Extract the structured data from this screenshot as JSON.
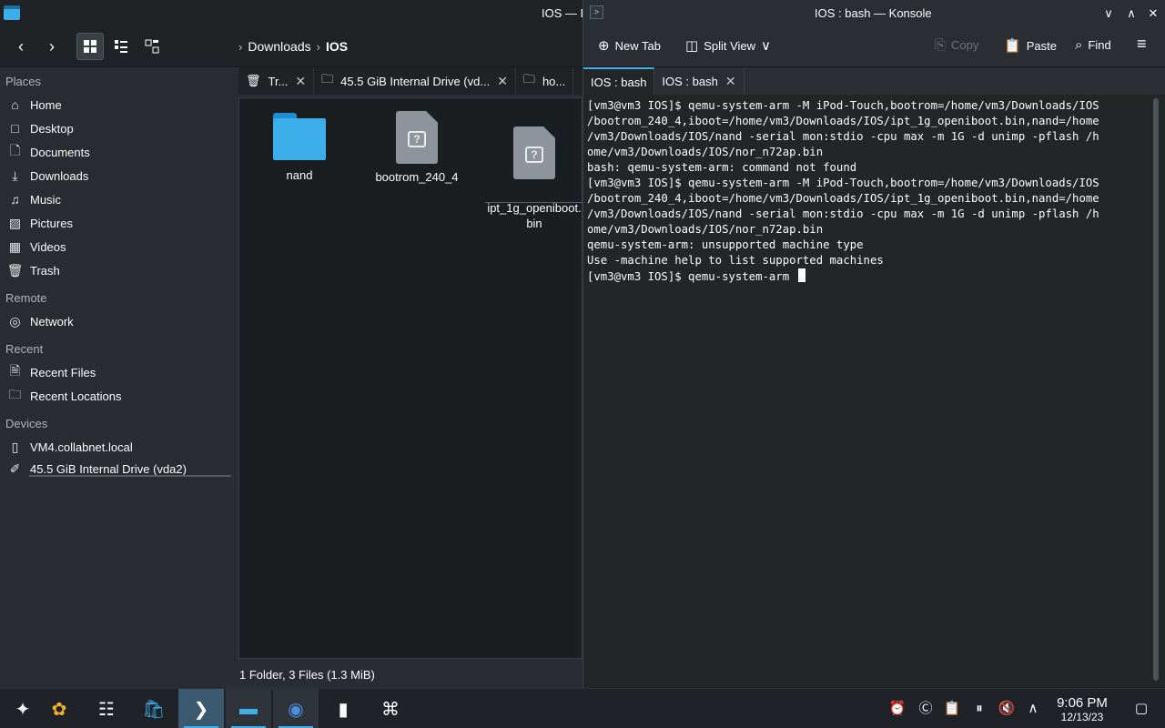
{
  "dolphin": {
    "title": "IOS — D",
    "breadcrumb": {
      "parent": "Downloads",
      "current": "IOS"
    },
    "sidebar": {
      "places_header": "Places",
      "places": [
        {
          "label": "Home",
          "icon": "home-icon"
        },
        {
          "label": "Desktop",
          "icon": "desktop-icon"
        },
        {
          "label": "Documents",
          "icon": "documents-icon"
        },
        {
          "label": "Downloads",
          "icon": "downloads-icon"
        },
        {
          "label": "Music",
          "icon": "music-icon"
        },
        {
          "label": "Pictures",
          "icon": "pictures-icon"
        },
        {
          "label": "Videos",
          "icon": "videos-icon"
        },
        {
          "label": "Trash",
          "icon": "trash-icon"
        }
      ],
      "remote_header": "Remote",
      "remote": [
        {
          "label": "Network",
          "icon": "network-icon"
        }
      ],
      "recent_header": "Recent",
      "recent": [
        {
          "label": "Recent Files",
          "icon": "recent-files-icon"
        },
        {
          "label": "Recent Locations",
          "icon": "recent-locations-icon"
        }
      ],
      "devices_header": "Devices",
      "devices": [
        {
          "label": "VM4.collabnet.local",
          "icon": "phone-icon"
        },
        {
          "label": "45.5 GiB Internal Drive (vda2)",
          "icon": "drive-icon"
        }
      ]
    },
    "tabs": [
      {
        "label": "Tr...",
        "icon": "trash-icon"
      },
      {
        "label": "45.5 GiB Internal Drive (vd...",
        "icon": "folder-icon"
      },
      {
        "label": "ho...",
        "icon": "folder-icon"
      }
    ],
    "files": [
      {
        "name": "nand",
        "type": "folder"
      },
      {
        "name": "bootrom_240_4",
        "type": "unknown"
      },
      {
        "name": "ipt_1g_openiboot.\nbin",
        "type": "unknown"
      }
    ],
    "status": "1 Folder, 3 Files (1.3 MiB)"
  },
  "konsole": {
    "title": "IOS : bash — Konsole",
    "toolbar": {
      "new_tab": "New Tab",
      "split_view": "Split View",
      "copy": "Copy",
      "paste": "Paste",
      "find": "Find"
    },
    "tabs": [
      {
        "label": "IOS : bash"
      },
      {
        "label": "IOS : bash"
      }
    ],
    "terminal_lines": [
      "[vm3@vm3 IOS]$ qemu-system-arm -M iPod-Touch,bootrom=/home/vm3/Downloads/IOS",
      "/bootrom_240_4,iboot=/home/vm3/Downloads/IOS/ipt_1g_openiboot.bin,nand=/home",
      "/vm3/Downloads/IOS/nand -serial mon:stdio -cpu max -m 1G -d unimp -pflash /h",
      "ome/vm3/Downloads/IOS/nor_n72ap.bin",
      "bash: qemu-system-arm: command not found",
      "[vm3@vm3 IOS]$ qemu-system-arm -M iPod-Touch,bootrom=/home/vm3/Downloads/IOS",
      "/bootrom_240_4,iboot=/home/vm3/Downloads/IOS/ipt_1g_openiboot.bin,nand=/home",
      "/vm3/Downloads/IOS/nand -serial mon:stdio -cpu max -m 1G -d unimp -pflash /h",
      "ome/vm3/Downloads/IOS/nor_n72ap.bin",
      "qemu-system-arm: unsupported machine type",
      "Use -machine help to list supported machines"
    ],
    "prompt_line": "[vm3@vm3 IOS]$ qemu-system-arm "
  },
  "taskbar": {
    "clock_time": "9:06 PM",
    "clock_date": "12/13/23"
  },
  "colors": {
    "accent": "#3daee9",
    "background": "#202326",
    "terminal_bg": "#232627"
  }
}
